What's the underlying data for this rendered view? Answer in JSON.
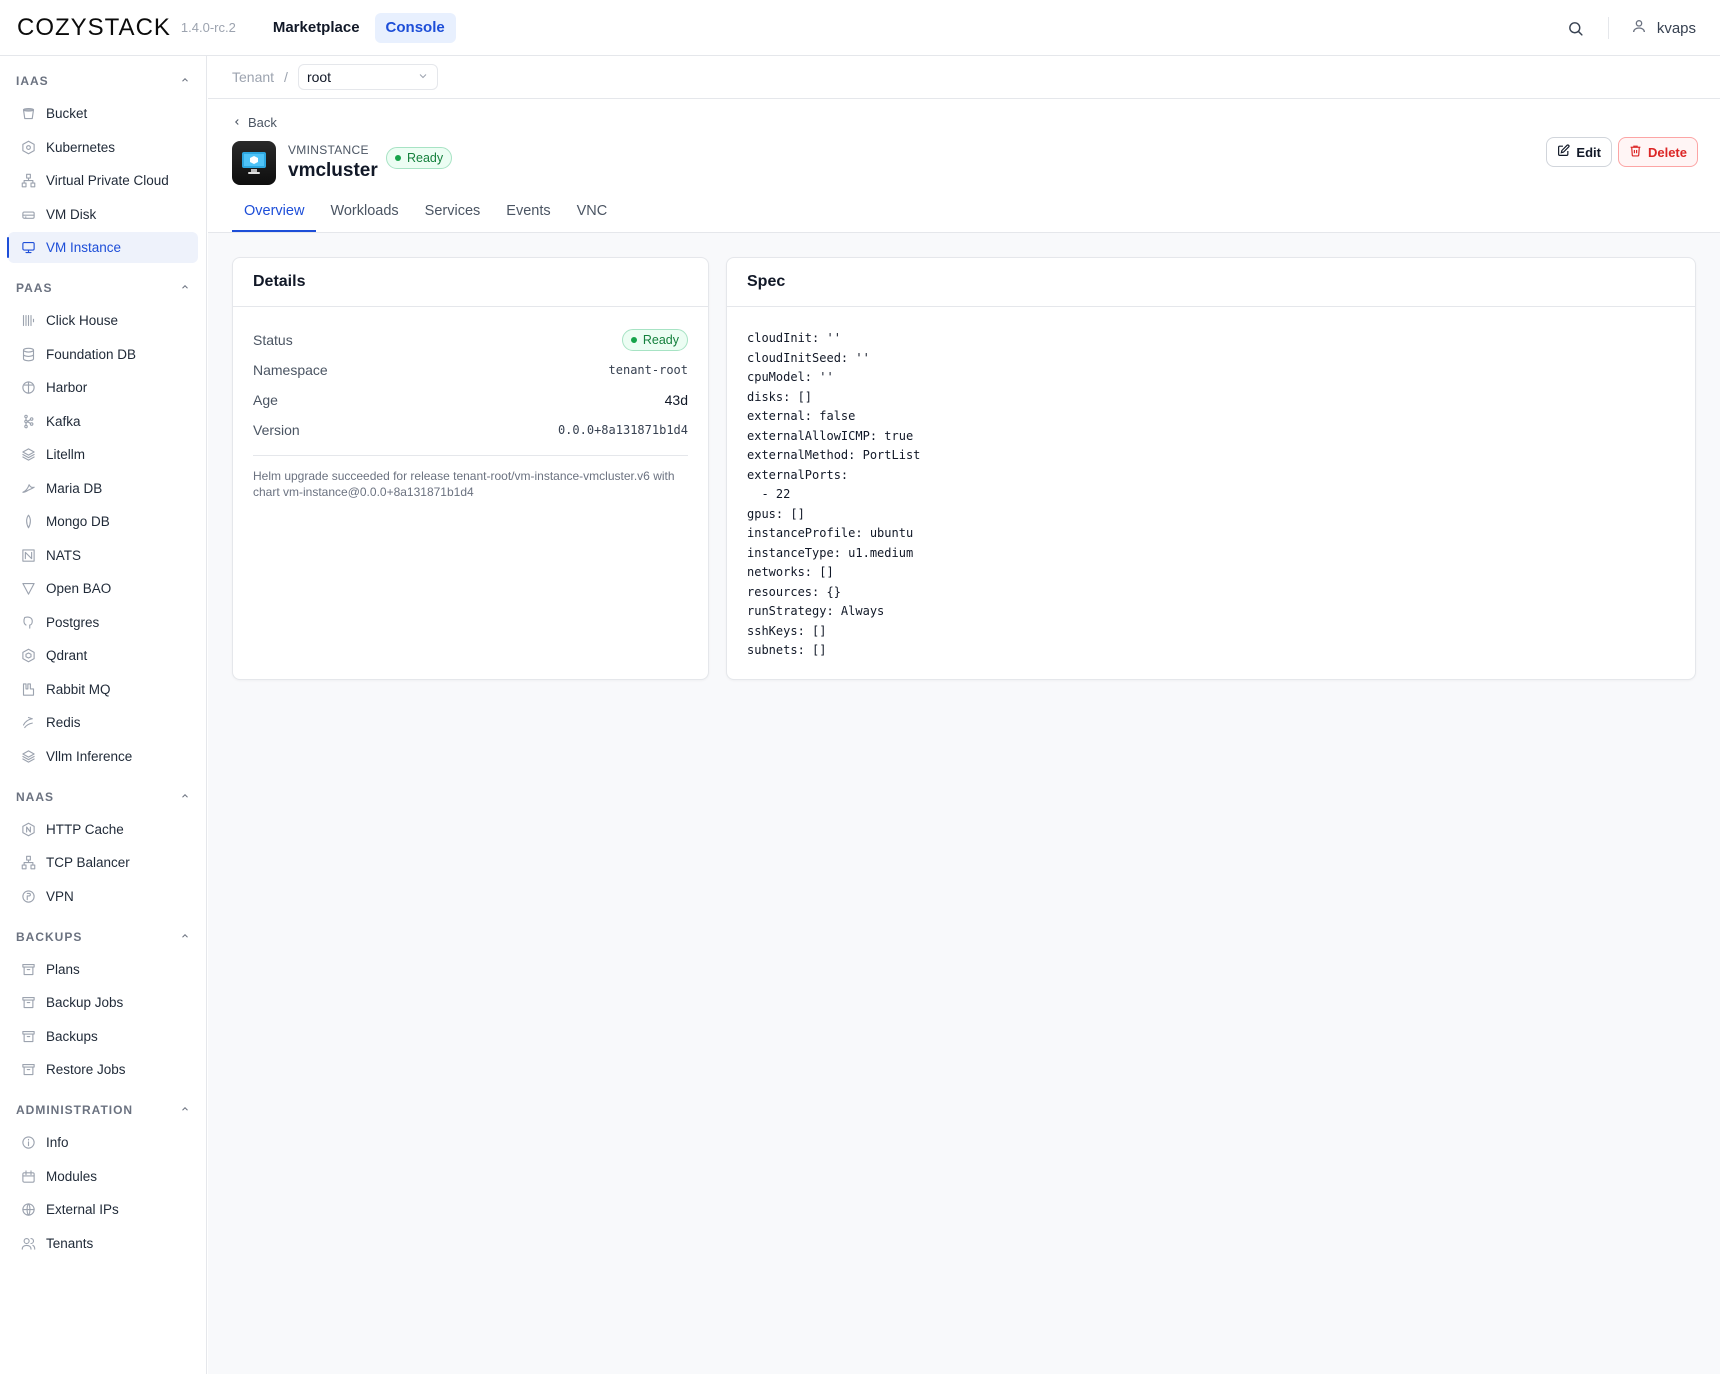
{
  "app": {
    "logo": "COZYSTACK",
    "version": "1.4.0-rc.2"
  },
  "topnav": [
    {
      "label": "Marketplace",
      "active": false
    },
    {
      "label": "Console",
      "active": true
    }
  ],
  "user": {
    "name": "kvaps"
  },
  "sidebar": {
    "sections": [
      {
        "title": "IAAS",
        "items": [
          {
            "label": "Bucket",
            "icon": "bucket-icon"
          },
          {
            "label": "Kubernetes",
            "icon": "kubernetes-icon"
          },
          {
            "label": "Virtual Private Cloud",
            "icon": "network-icon"
          },
          {
            "label": "VM Disk",
            "icon": "disk-icon"
          },
          {
            "label": "VM Instance",
            "icon": "monitor-icon",
            "active": true
          }
        ]
      },
      {
        "title": "PAAS",
        "items": [
          {
            "label": "Click House",
            "icon": "clickhouse-icon"
          },
          {
            "label": "Foundation DB",
            "icon": "database-icon"
          },
          {
            "label": "Harbor",
            "icon": "harbor-icon"
          },
          {
            "label": "Kafka",
            "icon": "kafka-icon"
          },
          {
            "label": "Litellm",
            "icon": "layers-icon"
          },
          {
            "label": "Maria DB",
            "icon": "mariadb-icon"
          },
          {
            "label": "Mongo DB",
            "icon": "leaf-icon"
          },
          {
            "label": "NATS",
            "icon": "nats-icon"
          },
          {
            "label": "Open BAO",
            "icon": "openbao-icon"
          },
          {
            "label": "Postgres",
            "icon": "postgres-icon"
          },
          {
            "label": "Qdrant",
            "icon": "qdrant-icon"
          },
          {
            "label": "Rabbit MQ",
            "icon": "rabbitmq-icon"
          },
          {
            "label": "Redis",
            "icon": "redis-icon"
          },
          {
            "label": "Vllm Inference",
            "icon": "layers-icon"
          }
        ]
      },
      {
        "title": "NAAS",
        "items": [
          {
            "label": "HTTP Cache",
            "icon": "nginx-icon"
          },
          {
            "label": "TCP Balancer",
            "icon": "network-icon"
          },
          {
            "label": "VPN",
            "icon": "vpn-icon"
          }
        ]
      },
      {
        "title": "BACKUPS",
        "items": [
          {
            "label": "Plans",
            "icon": "archive-icon"
          },
          {
            "label": "Backup Jobs",
            "icon": "archive-icon"
          },
          {
            "label": "Backups",
            "icon": "archive-icon"
          },
          {
            "label": "Restore Jobs",
            "icon": "archive-icon"
          }
        ]
      },
      {
        "title": "ADMINISTRATION",
        "items": [
          {
            "label": "Info",
            "icon": "info-icon"
          },
          {
            "label": "Modules",
            "icon": "package-icon"
          },
          {
            "label": "External IPs",
            "icon": "globe-icon"
          },
          {
            "label": "Tenants",
            "icon": "users-icon"
          }
        ]
      }
    ]
  },
  "breadcrumb": {
    "label": "Tenant",
    "separator": "/",
    "tenant": "root"
  },
  "resource": {
    "back": "Back",
    "kind": "VMINSTANCE",
    "name": "vmcluster",
    "status": "Ready",
    "edit": "Edit",
    "delete": "Delete"
  },
  "tabs": [
    {
      "label": "Overview",
      "active": true
    },
    {
      "label": "Workloads"
    },
    {
      "label": "Services"
    },
    {
      "label": "Events"
    },
    {
      "label": "VNC"
    }
  ],
  "details": {
    "title": "Details",
    "rows": [
      {
        "key": "Status",
        "value": "Ready"
      },
      {
        "key": "Namespace",
        "value": "tenant-root"
      },
      {
        "key": "Age",
        "value": "43d"
      },
      {
        "key": "Version",
        "value": "0.0.0+8a131871b1d4"
      }
    ],
    "note": "Helm upgrade succeeded for release tenant-root/vm-instance-vmcluster.v6 with chart vm-instance@0.0.0+8a131871b1d4"
  },
  "spec": {
    "title": "Spec",
    "yaml": "cloudInit: ''\ncloudInitSeed: ''\ncpuModel: ''\ndisks: []\nexternal: false\nexternalAllowICMP: true\nexternalMethod: PortList\nexternalPorts:\n  - 22\ngpus: []\ninstanceProfile: ubuntu\ninstanceType: u1.medium\nnetworks: []\nresources: {}\nrunStrategy: Always\nsshKeys: []\nsubnets: []"
  },
  "colors": {
    "accent": "#1d4ed8",
    "success": "#16a34a",
    "danger": "#dc2626"
  }
}
